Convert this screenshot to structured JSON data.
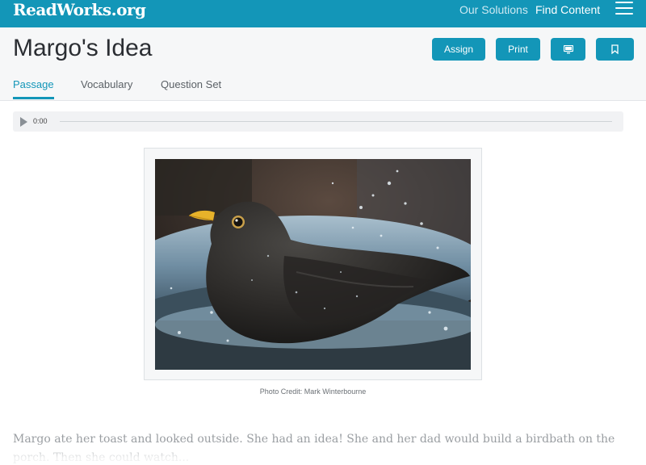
{
  "header": {
    "logo": "ReadWorks.org",
    "nav": [
      "Our Solutions",
      "Find Content"
    ],
    "menu_icon": "hamburger-menu-icon"
  },
  "page": {
    "title": "Margo's Idea",
    "buttons": {
      "assign": "Assign",
      "print": "Print",
      "present_icon": "monitor-icon",
      "bookmark_icon": "bookmark-icon"
    },
    "tabs": [
      "Passage",
      "Vocabulary",
      "Question Set"
    ],
    "active_tab": "Passage"
  },
  "audio": {
    "time": "0:00",
    "play_icon": "play-icon"
  },
  "image": {
    "subject": "blackbird-bathing-photo",
    "credit": "Photo Credit: Mark Winterbourne"
  },
  "passage": {
    "text": "Margo ate her toast and looked outside. She had an idea! She and her dad would build a birdbath on the porch. Then she could watch..."
  },
  "colors": {
    "brand": "#1396b8",
    "header_bg": "#f6f7f8",
    "passage_text": "#9a9ea2"
  }
}
